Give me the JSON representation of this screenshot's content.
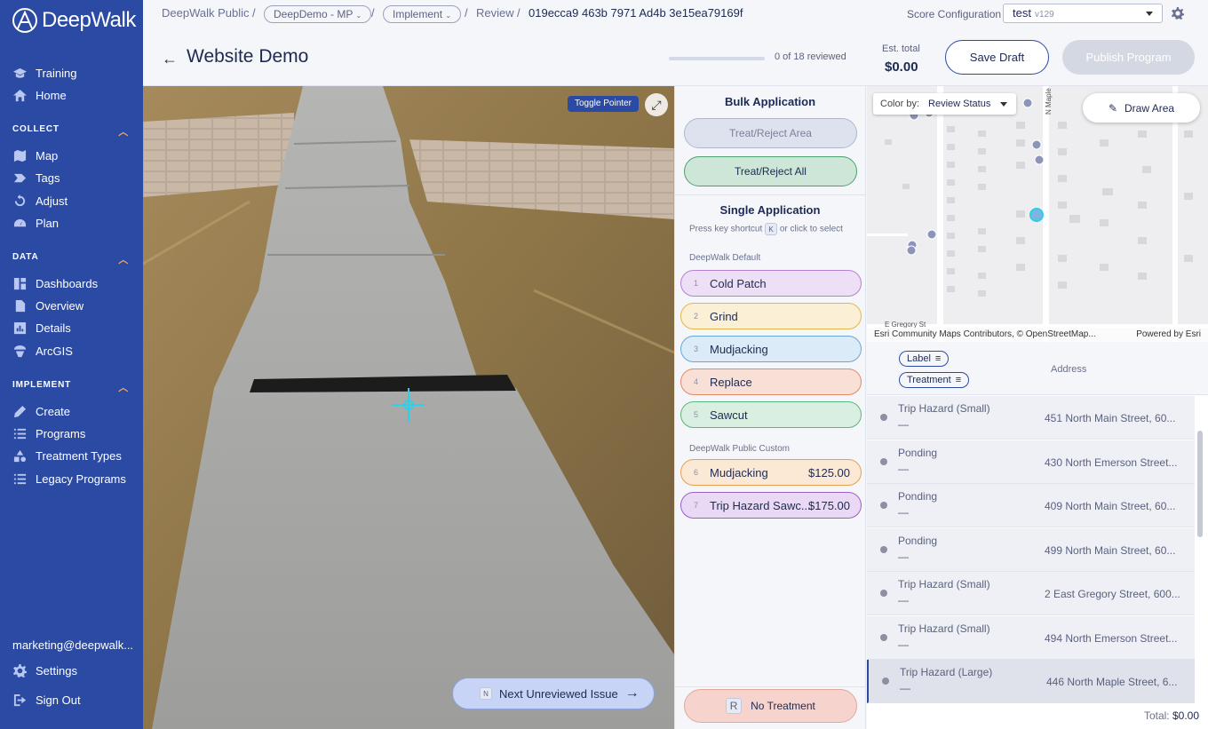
{
  "sidebar": {
    "logo": "DeepWalk",
    "top_items": [
      {
        "label": "Training",
        "icon": "graduation-cap-icon"
      },
      {
        "label": "Home",
        "icon": "home-icon"
      }
    ],
    "sections": [
      {
        "title": "COLLECT",
        "items": [
          {
            "label": "Map",
            "icon": "map-icon"
          },
          {
            "label": "Tags",
            "icon": "tag-icon"
          },
          {
            "label": "Adjust",
            "icon": "refresh-icon"
          },
          {
            "label": "Plan",
            "icon": "gauge-icon"
          }
        ]
      },
      {
        "title": "DATA",
        "items": [
          {
            "label": "Dashboards",
            "icon": "dashboard-icon"
          },
          {
            "label": "Overview",
            "icon": "document-icon"
          },
          {
            "label": "Details",
            "icon": "bar-chart-icon"
          },
          {
            "label": "ArcGIS",
            "icon": "globe-icon"
          }
        ]
      },
      {
        "title": "IMPLEMENT",
        "items": [
          {
            "label": "Create",
            "icon": "edit-icon"
          },
          {
            "label": "Programs",
            "icon": "list-icon"
          },
          {
            "label": "Treatment Types",
            "icon": "shapes-icon"
          },
          {
            "label": "Legacy Programs",
            "icon": "list-icon"
          }
        ]
      }
    ],
    "user_email": "marketing@deepwalk...",
    "settings": "Settings",
    "sign_out": "Sign Out"
  },
  "breadcrumb": {
    "root": "DeepWalk Public",
    "project": "DeepDemo - MP",
    "stage": "Implement",
    "page": "Review",
    "id": "019ecca9 463b 7971 Ad4b 3e15ea79169f"
  },
  "score_config": {
    "label": "Score Configuration",
    "value": "test",
    "version": "v129"
  },
  "header": {
    "title": "Website Demo",
    "progress_text": "0 of 18 reviewed",
    "progress_fraction": 0,
    "est_label": "Est. total",
    "est_value": "$0.00",
    "save_draft": "Save Draft",
    "publish": "Publish Program"
  },
  "photo": {
    "toggle_pointer": "Toggle Pointer",
    "next_key": "N",
    "next_label": "Next Unreviewed Issue"
  },
  "panel": {
    "bulk_title": "Bulk Application",
    "treat_area": "Treat/Reject Area",
    "treat_all": "Treat/Reject All",
    "single_title": "Single Application",
    "hint_prefix": "Press key shortcut",
    "hint_key": "K",
    "hint_suffix": "or click to select",
    "default_group": "DeepWalk Default",
    "default_treatments": [
      {
        "key": "1",
        "label": "Cold Patch",
        "color": "#b57fd6",
        "bg": "#ede0f6"
      },
      {
        "key": "2",
        "label": "Grind",
        "color": "#e3b54a",
        "bg": "#fbf0d6"
      },
      {
        "key": "3",
        "label": "Mudjacking",
        "color": "#6aa6d8",
        "bg": "#dcebf8"
      },
      {
        "key": "4",
        "label": "Replace",
        "color": "#e08a6a",
        "bg": "#f8e0d6"
      },
      {
        "key": "5",
        "label": "Sawcut",
        "color": "#5fb37e",
        "bg": "#d9efe1"
      }
    ],
    "custom_group": "DeepWalk Public Custom",
    "custom_treatments": [
      {
        "key": "6",
        "label": "Mudjacking",
        "price": "$125.00",
        "color": "#e6a04f",
        "bg": "#fbe9d6"
      },
      {
        "key": "7",
        "label": "Trip Hazard Sawc...",
        "price": "$175.00",
        "color": "#9a5fc4",
        "bg": "#ead9f4"
      }
    ],
    "no_treatment_key": "R",
    "no_treatment": "No Treatment"
  },
  "map": {
    "color_by_label": "Color by:",
    "color_by_value": "Review Status",
    "draw_area": "Draw Area",
    "street_maple": "N Maple",
    "street_gregory": "E Gregory St",
    "attribution": "Esri Community Maps Contributors, © OpenStreetMap...",
    "powered": "Powered by Esri"
  },
  "table": {
    "chip_label": "Label",
    "chip_treatment": "Treatment",
    "address_header": "Address",
    "rows": [
      {
        "label": "Trip Hazard (Small)",
        "treatment": "—",
        "address": "451 North Main Street, 60...",
        "selected": false
      },
      {
        "label": "Ponding",
        "treatment": "—",
        "address": "430 North Emerson Street...",
        "selected": false
      },
      {
        "label": "Ponding",
        "treatment": "—",
        "address": "409 North Main Street, 60...",
        "selected": false
      },
      {
        "label": "Ponding",
        "treatment": "—",
        "address": "499 North Main Street, 60...",
        "selected": false
      },
      {
        "label": "Trip Hazard (Small)",
        "treatment": "—",
        "address": "2 East Gregory Street, 600...",
        "selected": false
      },
      {
        "label": "Trip Hazard (Small)",
        "treatment": "—",
        "address": "494 North Emerson Street...",
        "selected": false
      },
      {
        "label": "Trip Hazard (Large)",
        "treatment": "—",
        "address": "446 North Maple Street, 6...",
        "selected": true
      }
    ],
    "total_label": "Total:",
    "total_value": "$0.00"
  }
}
